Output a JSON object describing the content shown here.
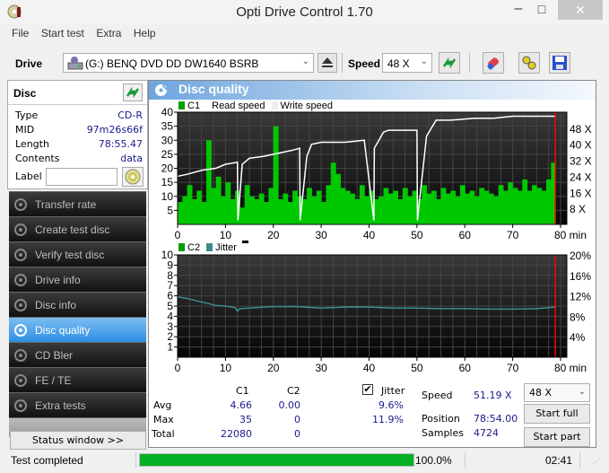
{
  "window": {
    "title": "Opti Drive Control 1.70",
    "minimize_glyph": "–",
    "maximize_glyph": "□",
    "close_glyph": "✕"
  },
  "menu": [
    "File",
    "Start test",
    "Extra",
    "Help"
  ],
  "toolbar": {
    "drive_label": "Drive",
    "drive_value": "(G:)   BENQ DVD DD DW1640 BSRB",
    "speed_label": "Speed",
    "speed_value": "48 X",
    "icons": [
      "refresh-drive-icon",
      "erase-icon",
      "settings-icon",
      "save-icon"
    ]
  },
  "disc": {
    "title": "Disc",
    "rows": [
      {
        "key": "Type",
        "value": "CD-R"
      },
      {
        "key": "MID",
        "value": "97m26s66f"
      },
      {
        "key": "Length",
        "value": "78:55.47"
      },
      {
        "key": "Contents",
        "value": "data"
      }
    ],
    "label_key": "Label",
    "label_value": ""
  },
  "nav": [
    {
      "label": "Transfer rate",
      "active": false
    },
    {
      "label": "Create test disc",
      "active": false
    },
    {
      "label": "Verify test disc",
      "active": false
    },
    {
      "label": "Drive info",
      "active": false
    },
    {
      "label": "Disc info",
      "active": false
    },
    {
      "label": "Disc quality",
      "active": true
    },
    {
      "label": "CD Bler",
      "active": false
    },
    {
      "label": "FE / TE",
      "active": false
    },
    {
      "label": "Extra tests",
      "active": false
    }
  ],
  "status_window_label": "Status window >>",
  "panel": {
    "title": "Disc quality"
  },
  "colors": {
    "c1": "#00c800",
    "read_speed": "#ffffff",
    "jitter": "#3c8c8c",
    "end_marker": "#ff0000",
    "header_accent": "#6ea5de",
    "progress": "#06b025"
  },
  "chart_data": [
    {
      "type": "bar",
      "title": "C1 / Read speed",
      "legend": [
        "C1",
        "Read speed",
        "Write speed"
      ],
      "xlabel": "min",
      "x_ticks": [
        "0",
        "10",
        "20",
        "30",
        "40",
        "50",
        "60",
        "70",
        "80 min"
      ],
      "xlim": [
        0,
        80
      ],
      "y_ticks_left": [
        "5",
        "10",
        "15",
        "20",
        "25",
        "30",
        "35",
        "40"
      ],
      "ylim_left": [
        0,
        40
      ],
      "y_ticks_right": [
        "8 X",
        "16 X",
        "24 X",
        "32 X",
        "40 X",
        "48 X"
      ],
      "ylim_right": [
        0,
        56
      ],
      "end_marker_min": 78.9,
      "series": [
        {
          "name": "Read speed",
          "unit": "X",
          "x": [
            0,
            2,
            5,
            8,
            10,
            12.5,
            12.6,
            13.5,
            15,
            18,
            20,
            22,
            24,
            25.5,
            25.6,
            27,
            28,
            30,
            35,
            39,
            41,
            41.1,
            43,
            44,
            46,
            50,
            50.1,
            52,
            54,
            57,
            62,
            66,
            70,
            74,
            78.9
          ],
          "values": [
            24,
            25,
            27,
            28,
            30,
            31,
            2,
            30,
            33,
            34,
            35,
            36,
            37,
            38,
            2,
            34,
            40,
            41,
            41,
            42,
            2,
            38,
            46,
            47,
            47,
            47,
            2,
            44,
            52,
            52,
            53,
            53,
            54,
            54,
            54
          ]
        },
        {
          "name": "C1",
          "x": [
            0,
            1,
            2,
            3,
            4,
            5,
            6,
            7,
            8,
            9,
            10,
            11,
            12,
            13,
            14,
            15,
            16,
            17,
            18,
            19,
            20,
            21,
            22,
            23,
            24,
            25,
            26,
            27,
            28,
            29,
            30,
            31,
            32,
            33,
            34,
            35,
            36,
            37,
            38,
            39,
            40,
            41,
            42,
            43,
            44,
            45,
            46,
            47,
            48,
            49,
            50,
            51,
            52,
            53,
            54,
            55,
            56,
            57,
            58,
            59,
            60,
            61,
            62,
            63,
            64,
            65,
            66,
            67,
            68,
            69,
            70,
            71,
            72,
            73,
            74,
            75,
            76,
            77,
            78
          ],
          "values": [
            8,
            10,
            14,
            9,
            12,
            8,
            30,
            13,
            17,
            10,
            15,
            9,
            12,
            6,
            14,
            10,
            9,
            11,
            8,
            13,
            35,
            9,
            11,
            8,
            12,
            10,
            9,
            13,
            10,
            12,
            8,
            14,
            22,
            18,
            13,
            12,
            11,
            9,
            14,
            10,
            12,
            9,
            10,
            13,
            11,
            12,
            9,
            13,
            10,
            12,
            9,
            14,
            11,
            12,
            9,
            13,
            11,
            12,
            10,
            14,
            11,
            12,
            10,
            13,
            12,
            11,
            10,
            14,
            12,
            15,
            13,
            12,
            16,
            12,
            14,
            13,
            12,
            16,
            22
          ]
        }
      ]
    },
    {
      "type": "line",
      "title": "C2 / Jitter",
      "legend": [
        "C2",
        "Jitter"
      ],
      "xlabel": "min",
      "x_ticks": [
        "0",
        "10",
        "20",
        "30",
        "40",
        "50",
        "60",
        "70",
        "80 min"
      ],
      "xlim": [
        0,
        80
      ],
      "y_ticks_left": [
        "1",
        "2",
        "3",
        "4",
        "5",
        "6",
        "7",
        "8",
        "9",
        "10"
      ],
      "ylim_left": [
        0,
        10
      ],
      "y_ticks_right": [
        "4%",
        "8%",
        "12%",
        "16%",
        "20%"
      ],
      "ylim_right": [
        0,
        20
      ],
      "end_marker_min": 78.9,
      "series": [
        {
          "name": "C2",
          "x": [
            0,
            78.9
          ],
          "values": [
            0,
            0
          ]
        },
        {
          "name": "Jitter",
          "unit": "%",
          "x": [
            0,
            2,
            4,
            6,
            8,
            10,
            12,
            12.5,
            13,
            15,
            18,
            20,
            25,
            30,
            35,
            40,
            45,
            50,
            55,
            60,
            65,
            70,
            75,
            78.9
          ],
          "values": [
            11.8,
            11.5,
            11.0,
            10.6,
            10.1,
            10.0,
            9.7,
            9.0,
            9.5,
            9.6,
            9.8,
            9.9,
            9.9,
            9.6,
            9.8,
            9.8,
            9.6,
            9.6,
            9.5,
            9.5,
            9.4,
            9.4,
            9.5,
            9.8
          ]
        }
      ]
    }
  ],
  "stats": {
    "col_headers": [
      "C1",
      "C2"
    ],
    "jitter_label": "Jitter",
    "jitter_checked": true,
    "rows": [
      {
        "label": "Avg",
        "c1": "4.66",
        "c2": "0.00",
        "jitter": "9.6%"
      },
      {
        "label": "Max",
        "c1": "35",
        "c2": "0",
        "jitter": "11.9%"
      },
      {
        "label": "Total",
        "c1": "22080",
        "c2": "0",
        "jitter": ""
      }
    ],
    "speed_label": "Speed",
    "speed_value": "51.19 X",
    "position_label": "Position",
    "position_value": "78:54.00",
    "samples_label": "Samples",
    "samples_value": "4724",
    "speed_select": "48 X",
    "start_full": "Start full",
    "start_part": "Start part"
  },
  "statusbar": {
    "text": "Test completed",
    "progress": 100.0,
    "progress_text": "100.0%",
    "time": "02:41"
  }
}
